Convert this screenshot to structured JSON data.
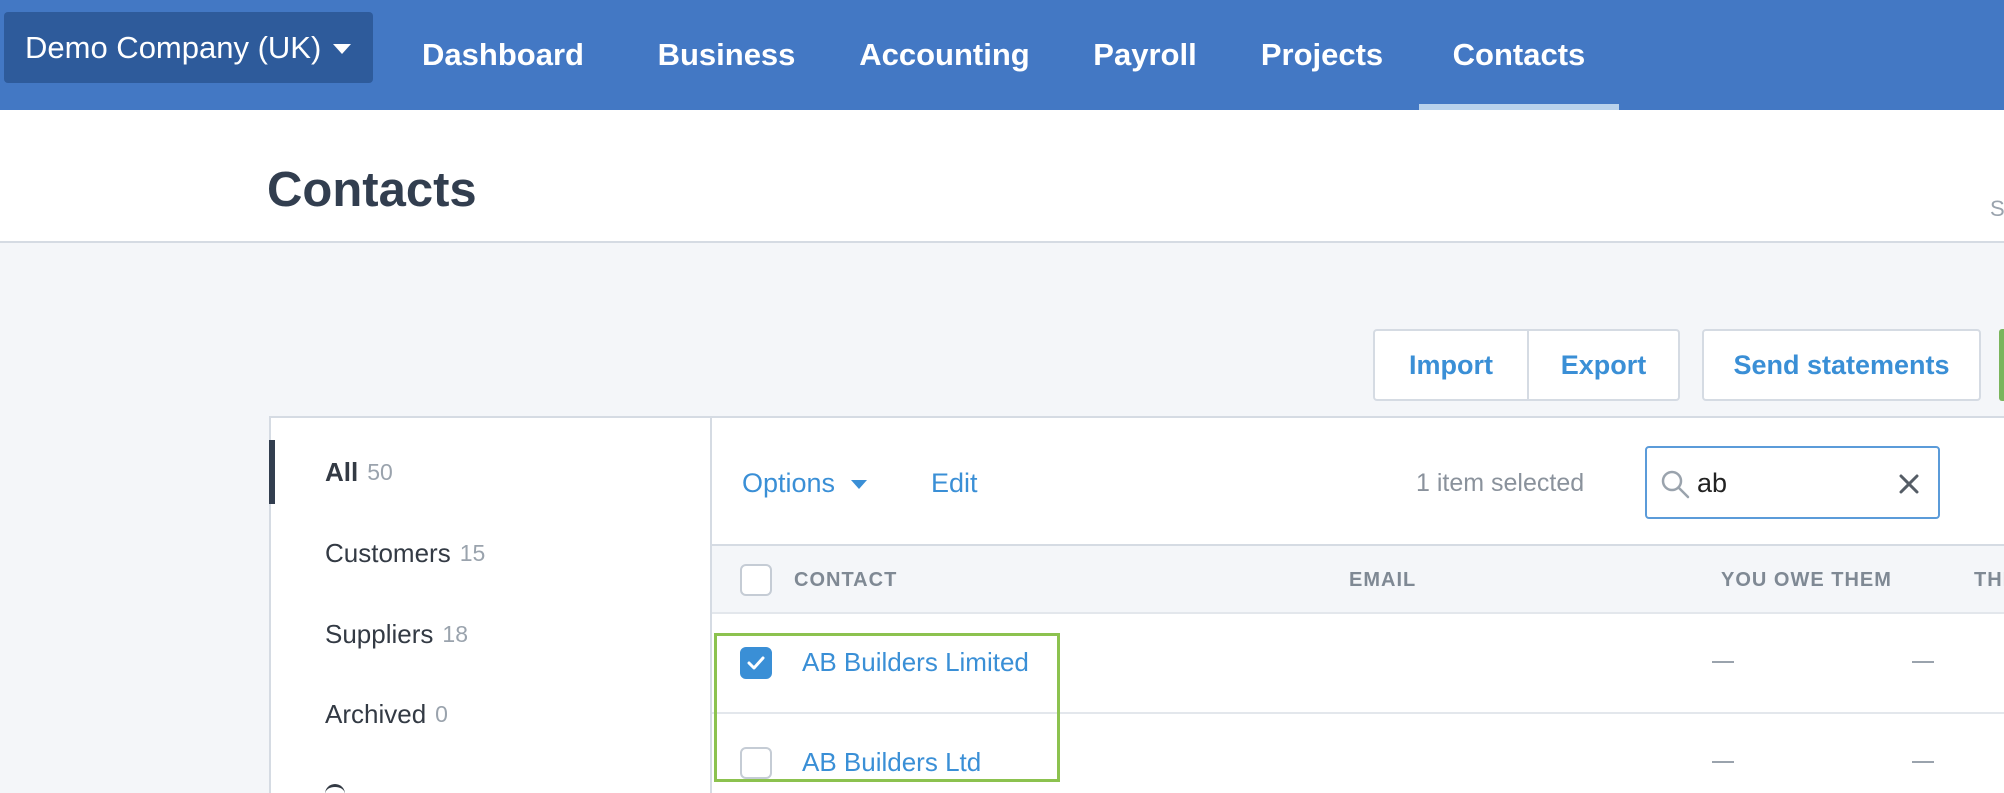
{
  "nav": {
    "org": "Demo Company (UK)",
    "items": [
      "Dashboard",
      "Business",
      "Accounting",
      "Payroll",
      "Projects",
      "Contacts"
    ],
    "active": "Contacts"
  },
  "page": {
    "title": "Contacts",
    "edge_text": "S"
  },
  "actions": {
    "import": "Import",
    "export": "Export",
    "send_statements": "Send statements"
  },
  "sidebar": {
    "items": [
      {
        "label": "All",
        "count": "50",
        "active": true
      },
      {
        "label": "Customers",
        "count": "15"
      },
      {
        "label": "Suppliers",
        "count": "18"
      },
      {
        "label": "Archived",
        "count": "0"
      }
    ]
  },
  "toolbar": {
    "options": "Options",
    "edit": "Edit",
    "selected": "1 item selected",
    "search_value": "ab"
  },
  "table": {
    "columns": [
      "CONTACT",
      "EMAIL",
      "YOU OWE THEM",
      "THE"
    ],
    "rows": [
      {
        "name": "AB Builders Limited",
        "checked": true,
        "you_owe": "—",
        "they_owe": "—"
      },
      {
        "name": "AB Builders Ltd",
        "checked": false,
        "you_owe": "—",
        "they_owe": "—"
      }
    ]
  },
  "colors": {
    "nav_bg": "#4378c4",
    "org_bg": "#2e5b9b",
    "link": "#3a8fd6",
    "highlight": "#8cc24f"
  }
}
